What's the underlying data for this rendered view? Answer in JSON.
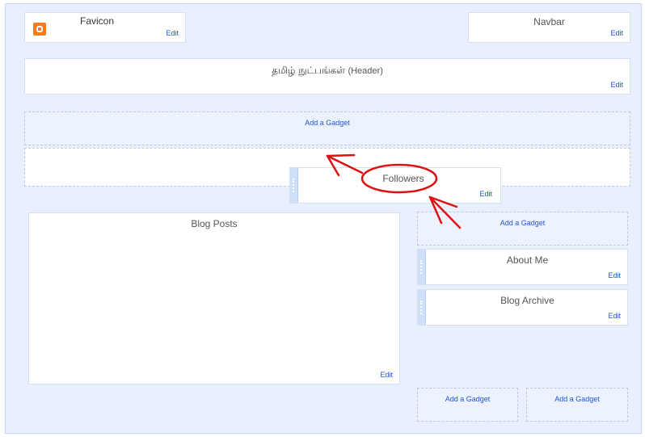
{
  "favicon": {
    "title": "Favicon",
    "edit": "Edit"
  },
  "navbar": {
    "title": "Navbar",
    "edit": "Edit"
  },
  "header": {
    "title_tamil": "தமிழ் நுட்பங்கள்",
    "title_suffix": "(Header)",
    "edit": "Edit"
  },
  "cross_column": {
    "add_gadget": "Add a Gadget"
  },
  "followers": {
    "title": "Followers",
    "edit": "Edit"
  },
  "main": {
    "title": "Blog Posts",
    "edit": "Edit"
  },
  "sidebar": {
    "add_gadget": "Add a Gadget",
    "about_me": {
      "title": "About Me",
      "edit": "Edit"
    },
    "blog_archive": {
      "title": "Blog Archive",
      "edit": "Edit"
    }
  },
  "footer": {
    "add_gadget_1": "Add a Gadget",
    "add_gadget_2": "Add a Gadget"
  },
  "colors": {
    "canvas": "#e9f0fd",
    "link": "#2255cc",
    "annotation": "#dd1111"
  },
  "icons": [
    "blogger-favicon-icon",
    "drag-handle-icon",
    "annotation-arrow-icon",
    "annotation-circle-icon"
  ]
}
